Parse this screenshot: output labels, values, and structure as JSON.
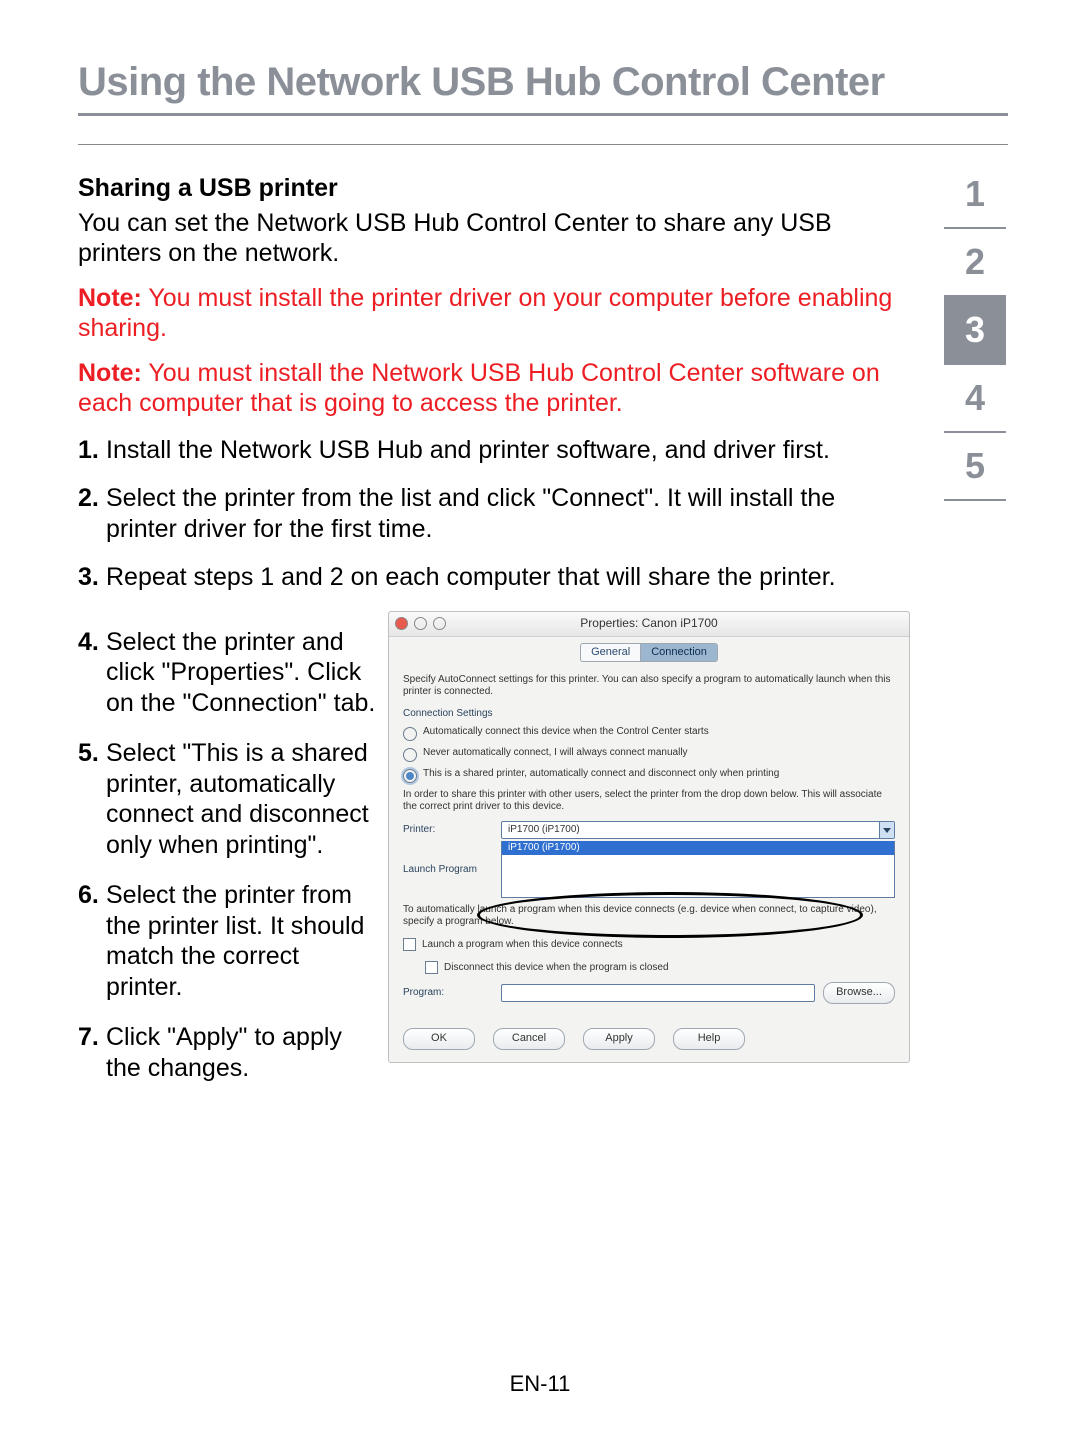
{
  "title": "Using the Network USB Hub Control Center",
  "nav": [
    "1",
    "2",
    "3",
    "4",
    "5"
  ],
  "nav_active_index": 2,
  "section_heading": "Sharing a USB printer",
  "intro": "You can set the Network USB Hub Control Center to share any USB printers on the network.",
  "note_label": "Note:",
  "note1": " You must install the printer driver on your computer before enabling sharing.",
  "note2": " You must install the Network USB Hub Control Center software on each computer that is going to access the printer.",
  "steps_top": [
    "Install the Network USB Hub and printer software, and driver first.",
    "Select the printer from the list and click \"Connect\". It will install the printer driver for the first time.",
    "Repeat steps 1 and 2 on each computer that will share the printer."
  ],
  "steps_side": [
    "Select the printer and click \"Properties\". Click on the \"Connection\" tab.",
    "Select \"This is a shared printer, automatically connect and disconnect only when printing\".",
    "Select the printer from the printer list. It should match the correct printer.",
    "Click \"Apply\" to apply the changes."
  ],
  "dialog": {
    "title": "Properties: Canon iP1700",
    "tabs": {
      "general": "General",
      "connection": "Connection"
    },
    "desc": "Specify AutoConnect settings for this printer. You can also specify a program to automatically launch when this printer is connected.",
    "group_title": "Connection Settings",
    "radio1": "Automatically connect this device when the Control Center starts",
    "radio2": "Never automatically connect, I will always connect manually",
    "radio3": "This is a shared printer, automatically connect and disconnect only when printing",
    "help": "In order to share this printer with other users, select the printer from the drop down below. This will associate the correct print driver to this device.",
    "printer_label": "Printer:",
    "printer_value": "iP1700 (iP1700)",
    "drop_value": "iP1700 (iP1700)",
    "launch_label": "Launch Program",
    "auto_text": "To automatically launch a program when this device connects (e.g. device when connect, to capture video), specify a program below.",
    "chk1": "Launch a program when this device connects",
    "chk2": "Disconnect this device when the program is closed",
    "program_label": "Program:",
    "browse": "Browse...",
    "ok": "OK",
    "cancel": "Cancel",
    "apply": "Apply",
    "help_btn": "Help"
  },
  "footer": "EN-11"
}
